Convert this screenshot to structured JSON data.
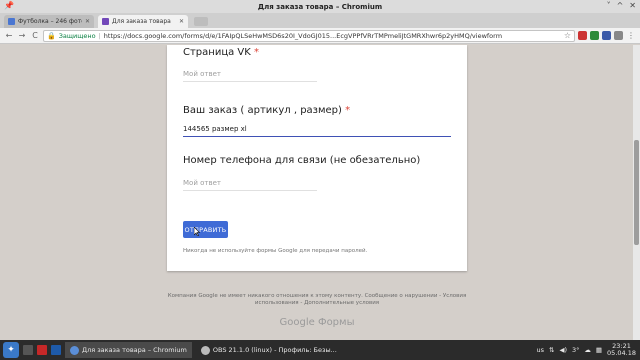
{
  "window": {
    "title": "Для заказа товара – Chromium",
    "pin_icon": "pin-icon",
    "controls": [
      "˅",
      "^",
      "✕"
    ]
  },
  "tabs": [
    {
      "label": "Футболка – 246 фото",
      "close": "✕",
      "favicon_color": "#4a76d1",
      "active": false
    },
    {
      "label": "Для заказа товара",
      "close": "✕",
      "favicon_color": "#7248b9",
      "active": true
    }
  ],
  "toolbar": {
    "back": "←",
    "forward": "→",
    "reload": "C",
    "secure_label": "Защищено",
    "url": "https://docs.google.com/forms/d/e/1FAIpQLSeHwMSD6s20I_VdoGJ015...EcgVPPfVRrTMPmeliJtGMRXhwr6p2yHMQ/viewform",
    "menu": "⋮"
  },
  "form": {
    "q1": {
      "label": "Страница VK",
      "required_mark": "*",
      "placeholder": "Мой ответ"
    },
    "q2": {
      "label": "Ваш заказ ( артикул , размер)",
      "required_mark": "*",
      "value": "144565 размер xl"
    },
    "q3": {
      "label": "Номер телефона для связи (не обезательно)",
      "placeholder": "Мой ответ"
    },
    "submit_label": "ОТПРАВИТЬ",
    "password_note": "Никогда не используйте формы Google для передачи паролей."
  },
  "footer": {
    "text": "Компания Google не имеет никакого отношения к этому контенту. Сообщение о нарушении - Условия использования - Дополнительные условия",
    "logo": "Google Формы"
  },
  "taskbar": {
    "items": [
      {
        "label": "Для заказа товара – Chromium",
        "icon_color": "#5b8fd8",
        "active": true
      },
      {
        "label": "OBS 21.1.0 (linux) - Профиль: Безы...",
        "icon_color": "#bbbbbb",
        "active": false
      }
    ],
    "tray": {
      "keyboard": "us",
      "temperature": "3°",
      "time": "23:21",
      "date": "05.04.18"
    }
  },
  "colors": {
    "form_accent": "#3f51b5",
    "submit_button": "#3f6bd6",
    "required": "#db4437",
    "page_background": "#d4cfca"
  }
}
